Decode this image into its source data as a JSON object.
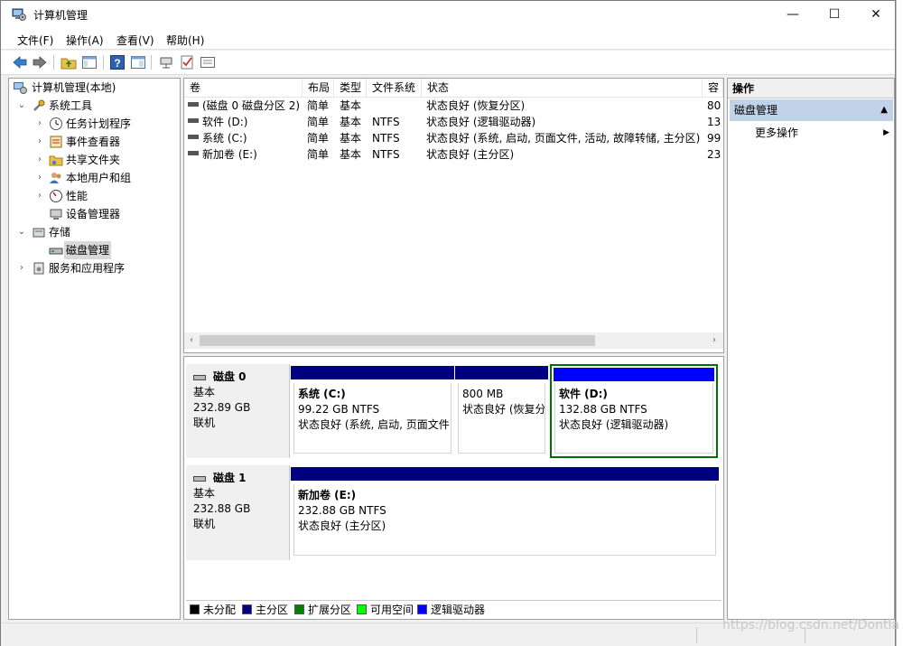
{
  "window": {
    "title": "计算机管理",
    "controls": {
      "minimize": "—",
      "maximize": "☐",
      "close": "✕"
    }
  },
  "menu": [
    "文件(F)",
    "操作(A)",
    "查看(V)",
    "帮助(H)"
  ],
  "tree": {
    "root": "计算机管理(本地)",
    "items": [
      {
        "label": "系统工具",
        "icon": "tools-icon"
      },
      {
        "label": "任务计划程序",
        "icon": "clock-icon"
      },
      {
        "label": "事件查看器",
        "icon": "event-viewer-icon"
      },
      {
        "label": "共享文件夹",
        "icon": "shared-folder-icon"
      },
      {
        "label": "本地用户和组",
        "icon": "users-icon"
      },
      {
        "label": "性能",
        "icon": "performance-icon"
      },
      {
        "label": "设备管理器",
        "icon": "device-manager-icon"
      },
      {
        "label": "存储",
        "icon": "storage-icon"
      },
      {
        "label": "磁盘管理",
        "icon": "disk-icon"
      },
      {
        "label": "服务和应用程序",
        "icon": "services-icon"
      }
    ]
  },
  "volumes": {
    "columns": [
      "卷",
      "布局",
      "类型",
      "文件系统",
      "状态",
      "容"
    ],
    "rows": [
      {
        "name": "(磁盘 0 磁盘分区 2)",
        "layout": "简单",
        "type": "基本",
        "fs": "",
        "status": "状态良好 (恢复分区)",
        "cap": "80"
      },
      {
        "name": "软件 (D:)",
        "layout": "简单",
        "type": "基本",
        "fs": "NTFS",
        "status": "状态良好 (逻辑驱动器)",
        "cap": "13"
      },
      {
        "name": "系统 (C:)",
        "layout": "简单",
        "type": "基本",
        "fs": "NTFS",
        "status": "状态良好 (系统, 启动, 页面文件, 活动, 故障转储, 主分区)",
        "cap": "99"
      },
      {
        "name": "新加卷 (E:)",
        "layout": "简单",
        "type": "基本",
        "fs": "NTFS",
        "status": "状态良好 (主分区)",
        "cap": "23"
      }
    ]
  },
  "disks": [
    {
      "name": "磁盘 0",
      "kind": "基本",
      "size": "232.89 GB",
      "state": "联机",
      "partitions": [
        {
          "title": "系统 (C:)",
          "size": "99.22 GB NTFS",
          "status": "状态良好 (系统, 启动, 页面文件"
        },
        {
          "title": "",
          "size": "800 MB",
          "status": "状态良好 (恢复分"
        },
        {
          "title": "软件 (D:)",
          "size": "132.88 GB NTFS",
          "status": "状态良好 (逻辑驱动器)"
        }
      ]
    },
    {
      "name": "磁盘 1",
      "kind": "基本",
      "size": "232.88 GB",
      "state": "联机",
      "partitions": [
        {
          "title": "新加卷 (E:)",
          "size": "232.88 GB NTFS",
          "status": "状态良好 (主分区)"
        }
      ]
    }
  ],
  "legend": [
    {
      "label": "未分配",
      "color": "#000000"
    },
    {
      "label": "主分区",
      "color": "#000080"
    },
    {
      "label": "扩展分区",
      "color": "#008000"
    },
    {
      "label": "可用空间",
      "color": "#00ff00"
    },
    {
      "label": "逻辑驱动器",
      "color": "#0000ff"
    }
  ],
  "actions": {
    "header": "操作",
    "section": "磁盘管理",
    "item": "更多操作"
  },
  "watermark": "https://blog.csdn.net/Dontla",
  "colors": {
    "primary_bar": "#000080",
    "logical_bar": "#0000ff",
    "selected_border": "#007000",
    "action_section": "#c0d3e8"
  }
}
